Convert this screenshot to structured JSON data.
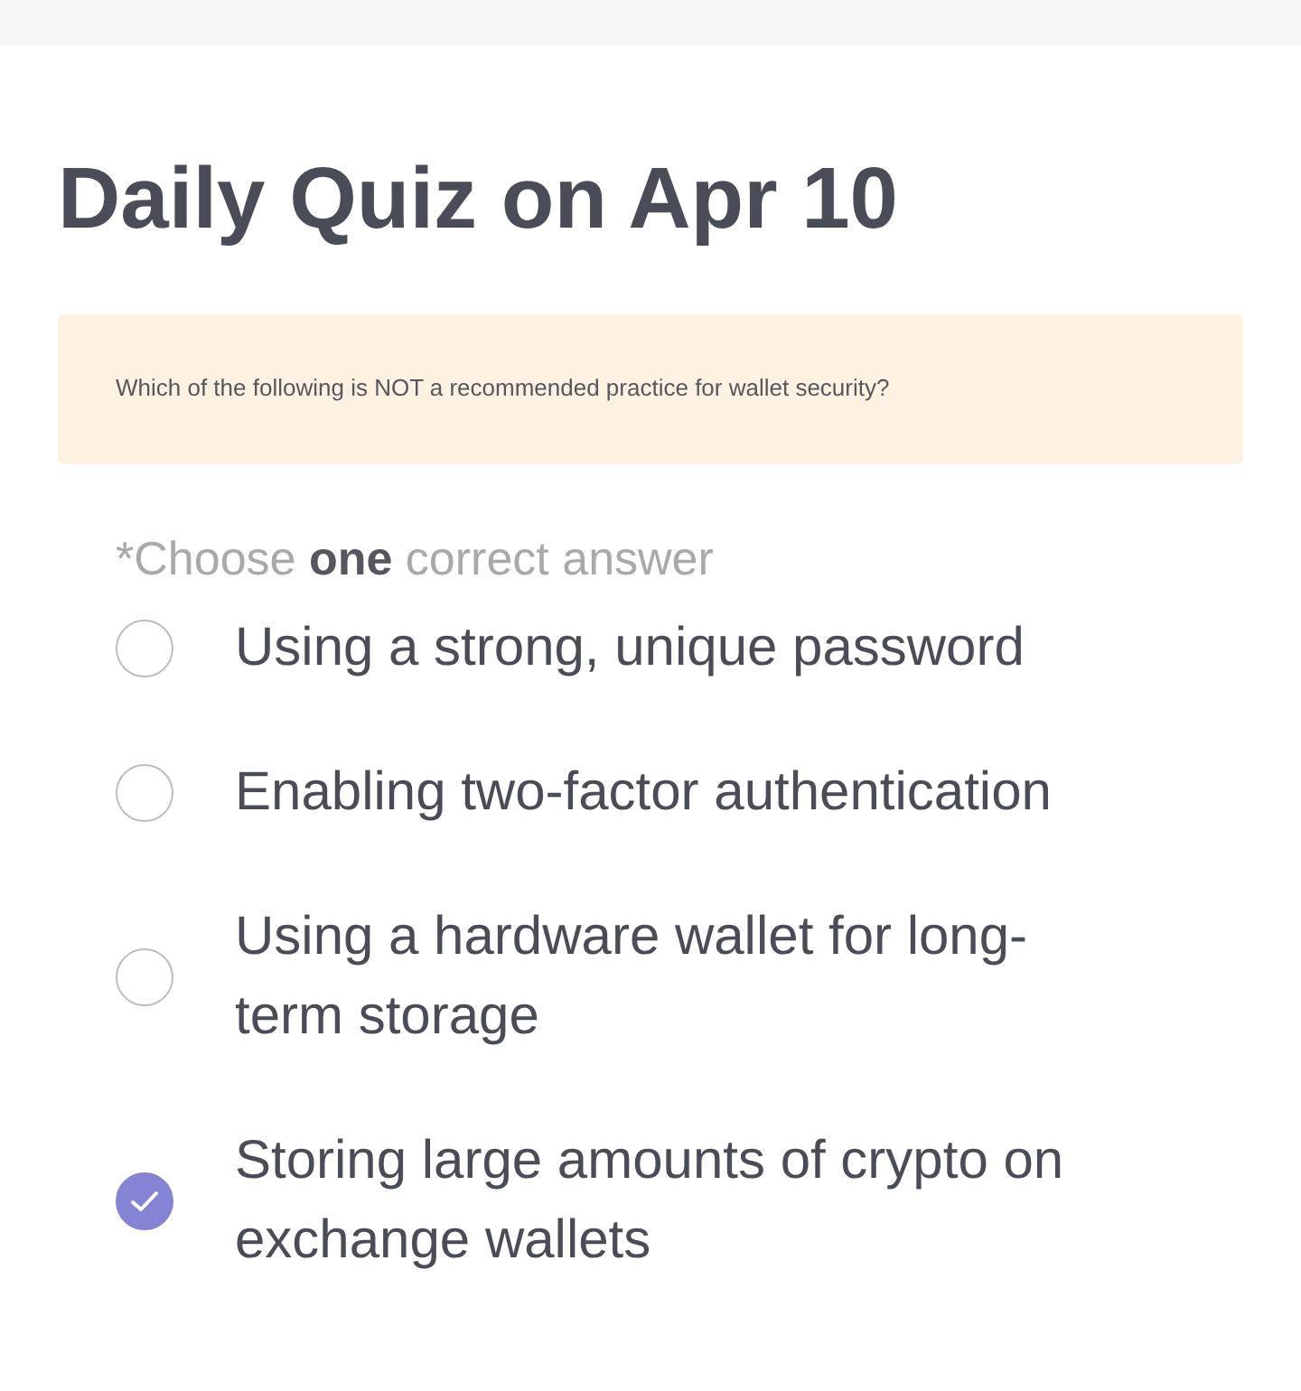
{
  "title": "Daily Quiz on Apr 10",
  "question": "Which of the following is NOT a recommended practice for wallet security?",
  "instruction": "*Choose **one** correct answer",
  "options": [
    {
      "label": "Using a strong, unique password",
      "selected": false
    },
    {
      "label": "Enabling two-factor authentication",
      "selected": false
    },
    {
      "label": "Using a hardware wallet for long-term storage",
      "selected": false
    },
    {
      "label": "Storing large amounts of crypto on exchange wallets",
      "selected": true
    }
  ]
}
